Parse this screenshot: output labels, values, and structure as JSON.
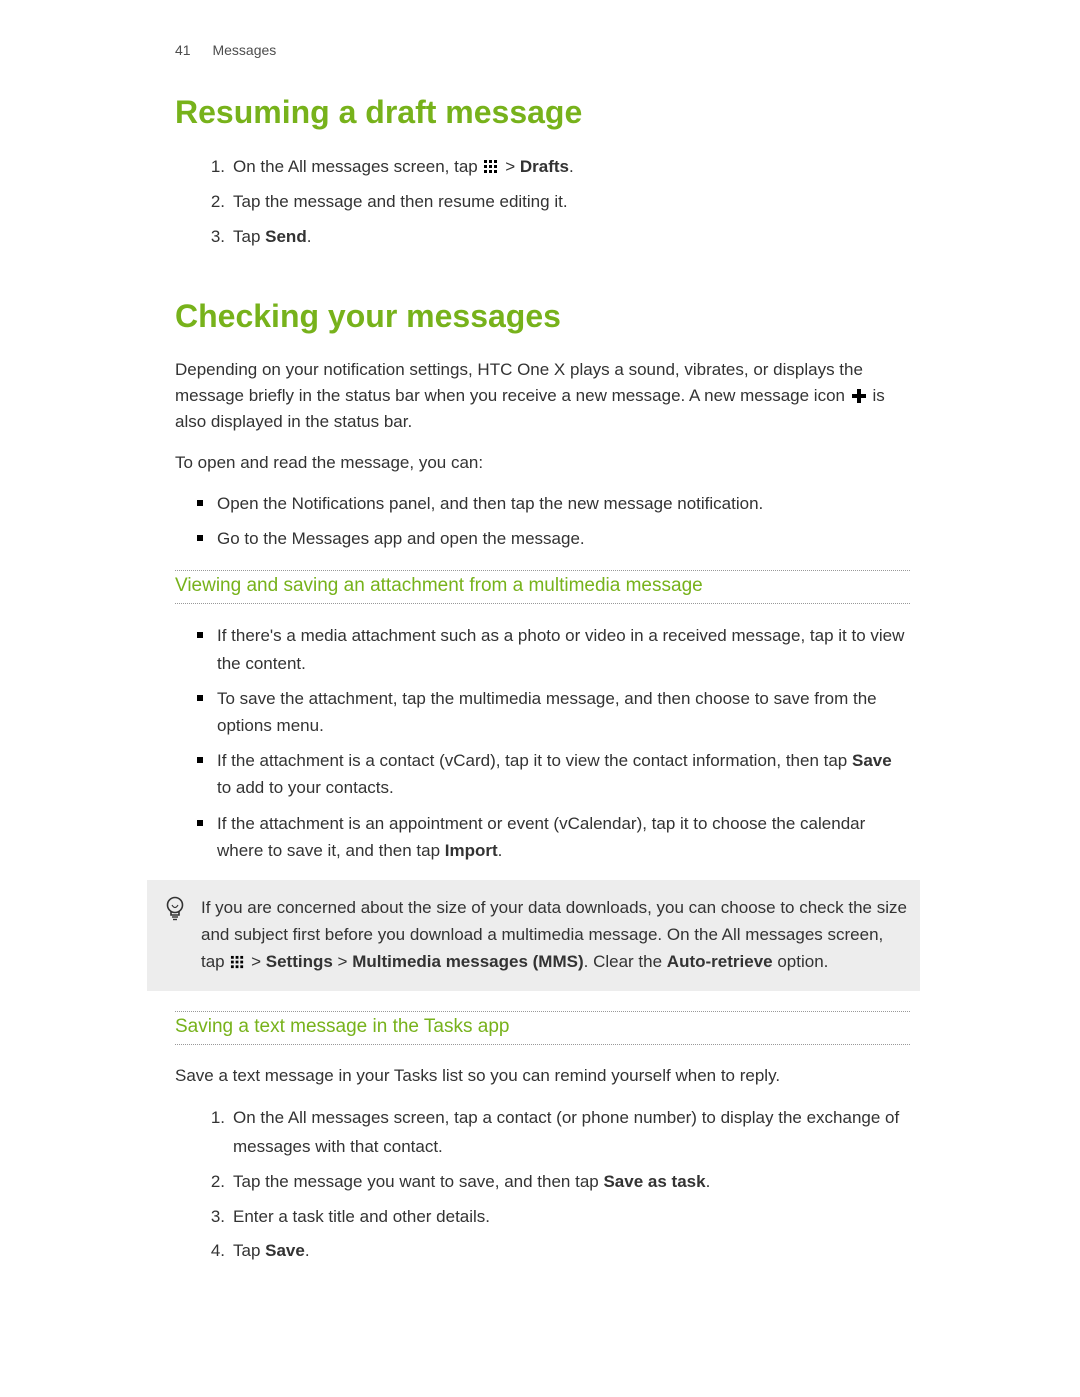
{
  "header": {
    "page_number": "41",
    "chapter": "Messages"
  },
  "section1": {
    "title": "Resuming a draft message",
    "items": [
      {
        "n": "1.",
        "pre": "On the All messages screen, tap ",
        "icon": "menu",
        "post_pre": " > ",
        "bold": "Drafts",
        "post": "."
      },
      {
        "n": "2.",
        "text": "Tap the message and then resume editing it."
      },
      {
        "n": "3.",
        "pre": "Tap ",
        "bold": "Send",
        "post": "."
      }
    ]
  },
  "section2": {
    "title": "Checking your messages",
    "p1_pre": "Depending on your notification settings, HTC One X plays a sound, vibrates, or displays the message briefly in the status bar when you receive a new message. A new message icon ",
    "p1_post": " is also displayed in the status bar.",
    "p2": "To open and read the message, you can:",
    "bullets": [
      "Open the Notifications panel, and then tap the new message notification.",
      "Go to the Messages app and open the message."
    ]
  },
  "subsection1": {
    "title": "Viewing and saving an attachment from a multimedia message",
    "bullets": [
      {
        "text": "If there's a media attachment such as a photo or video in a received message, tap it to view the content."
      },
      {
        "text": "To save the attachment, tap the multimedia message, and then choose to save from the options menu."
      },
      {
        "pre": "If the attachment is a contact (vCard), tap it to view the contact information, then tap ",
        "bold": "Save",
        "post": " to add to your contacts."
      },
      {
        "pre": "If the attachment is an appointment or event (vCalendar), tap it to choose the calendar where to save it, and then tap ",
        "bold": "Import",
        "post": "."
      }
    ]
  },
  "tip": {
    "pre": "If you are concerned about the size of your data downloads, you can choose to check the size and subject first before you download a multimedia message. On the All messages screen, tap ",
    "icon": "menu",
    "mid1": " > ",
    "bold1": "Settings",
    "mid2": " > ",
    "bold2": "Multimedia messages (MMS)",
    "mid3": ". Clear the ",
    "bold3": "Auto-retrieve",
    "post": " option."
  },
  "subsection2": {
    "title": "Saving a text message in the Tasks app",
    "intro": "Save a text message in your Tasks list so you can remind yourself when to reply.",
    "items": [
      {
        "n": "1.",
        "text": "On the All messages screen, tap a contact (or phone number) to display the exchange of messages with that contact."
      },
      {
        "n": "2.",
        "pre": "Tap the message you want to save, and then tap ",
        "bold": "Save as task",
        "post": "."
      },
      {
        "n": "3.",
        "text": "Enter a task title and other details."
      },
      {
        "n": "4.",
        "pre": "Tap ",
        "bold": "Save",
        "post": "."
      }
    ]
  }
}
